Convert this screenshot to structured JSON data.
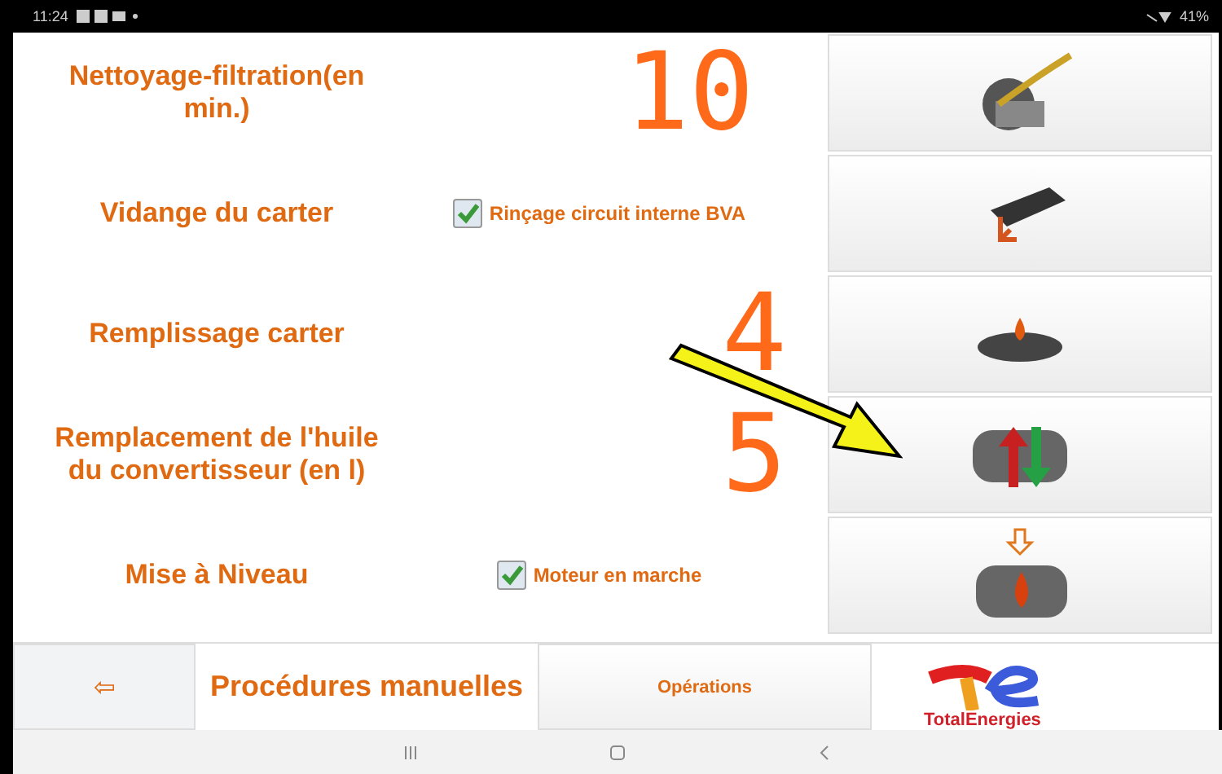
{
  "status_bar": {
    "time": "11:24",
    "battery": "41%"
  },
  "rows": [
    {
      "label": "Nettoyage-filtration(en min.)",
      "value": "10",
      "kind": "brush"
    },
    {
      "label": "Vidange du carter",
      "checkbox": {
        "label": "Rinçage circuit interne BVA",
        "checked": true
      },
      "kind": "drain"
    },
    {
      "label": "Remplissage carter",
      "value": "4",
      "kind": "fill"
    },
    {
      "label": "Remplacement de l'huile du convertisseur (en l)",
      "value": "5",
      "kind": "exchange"
    },
    {
      "label": "Mise à Niveau",
      "checkbox": {
        "label": "Moteur en marche",
        "checked": true
      },
      "kind": "level"
    }
  ],
  "bottom_bar": {
    "back": "⇦",
    "title": "Procédures manuelles",
    "tab": "Opérations",
    "logo_text": "TotalEnergies"
  }
}
